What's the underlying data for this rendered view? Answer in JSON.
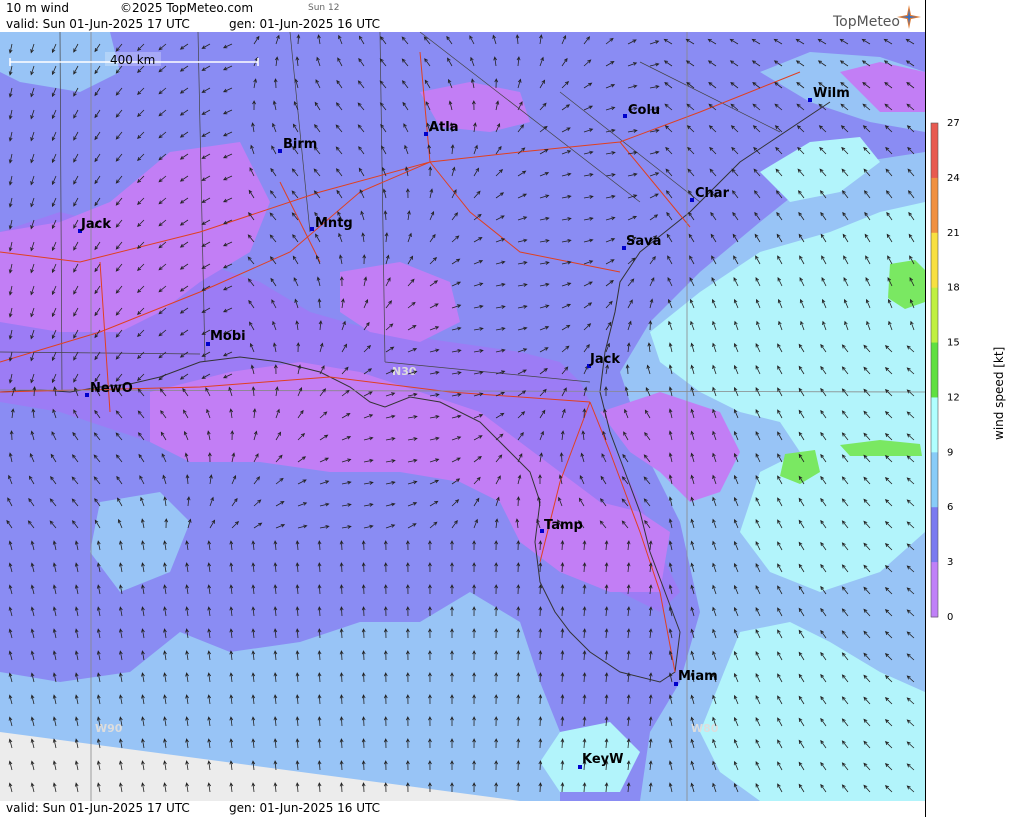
{
  "header": {
    "title": "10 m wind",
    "copyright": "©2025 TopMeteo.com",
    "day_tag": "Sun 12",
    "valid": "valid:  Sun  01-Jun-2025  17 UTC",
    "generated": "gen: 01-Jun-2025 16 UTC"
  },
  "footer": {
    "valid": "valid:  Sun  01-Jun-2025  17 UTC",
    "generated": "gen: 01-Jun-2025 16 UTC"
  },
  "brand": {
    "logo": "TopMeteo",
    "logo_icon": "compass-star-icon"
  },
  "scale_bar": "400 km",
  "gridlines": {
    "lat_label": "N30",
    "lon_labels": [
      "W90",
      "W80"
    ]
  },
  "cities": [
    {
      "id": "wilm",
      "label": "Wilm"
    },
    {
      "id": "colu",
      "label": "Colu"
    },
    {
      "id": "atla",
      "label": "Atla"
    },
    {
      "id": "birm",
      "label": "Birm"
    },
    {
      "id": "char",
      "label": "Char"
    },
    {
      "id": "jack-ms",
      "label": "Jack"
    },
    {
      "id": "mntg",
      "label": "Mntg"
    },
    {
      "id": "sava",
      "label": "Sava"
    },
    {
      "id": "mobi",
      "label": "Mobi"
    },
    {
      "id": "jack-fl",
      "label": "Jack"
    },
    {
      "id": "newo",
      "label": "NewO"
    },
    {
      "id": "tamp",
      "label": "Tamp"
    },
    {
      "id": "miam",
      "label": "Miam"
    },
    {
      "id": "keyw",
      "label": "KeyW"
    }
  ],
  "legend": {
    "title": "wind speed [kt]",
    "ticks": [
      "27",
      "24",
      "21",
      "18",
      "15",
      "12",
      "9",
      "6",
      "3",
      "0"
    ],
    "colors": [
      "#e85a50",
      "#f09040",
      "#f8e040",
      "#c0f040",
      "#60e040",
      "#b0ffff",
      "#88ccf8",
      "#7a7af0",
      "#c080f8"
    ]
  },
  "colors": {
    "calm": "#c27ef5",
    "light": "#9c7cf5",
    "moderate": "#8a8cf3",
    "fresh": "#98c4f6",
    "breezy": "#b2f4fb",
    "strong": "#7ae862",
    "roads": "#e04020",
    "borders": "#333333",
    "cities": "#0000cc"
  }
}
